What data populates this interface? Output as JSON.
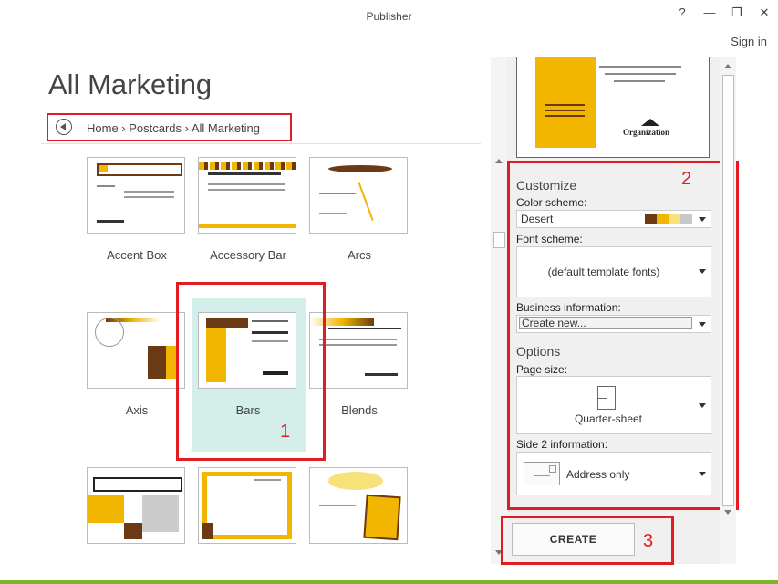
{
  "window": {
    "title": "Publisher",
    "help": "?",
    "minimize": "—",
    "restore": "❐",
    "close": "✕"
  },
  "account": {
    "sign_in": "Sign in"
  },
  "gallery": {
    "heading": "All Marketing",
    "breadcrumb": "Home  ›  Postcards  ›  All Marketing",
    "templates": [
      {
        "name": "Accent Box"
      },
      {
        "name": "Accessory Bar"
      },
      {
        "name": "Arcs"
      },
      {
        "name": "Axis"
      },
      {
        "name": "Bars",
        "selected": true
      },
      {
        "name": "Blends"
      }
    ]
  },
  "customize": {
    "heading": "Customize",
    "color_scheme_label": "Color scheme:",
    "color_scheme_value": "Desert",
    "swatches": [
      "#6b3a14",
      "#f2b600",
      "#f7e27a",
      "#c8c8c8"
    ],
    "font_scheme_label": "Font scheme:",
    "font_scheme_value": "(default template fonts)",
    "business_label": "Business information:",
    "business_value": "Create new..."
  },
  "options": {
    "heading": "Options",
    "page_size_label": "Page size:",
    "page_size_value": "Quarter-sheet",
    "side2_label": "Side 2 information:",
    "side2_value": "Address only"
  },
  "actions": {
    "create": "CREATE"
  },
  "annotations": {
    "n1": "1",
    "n2": "2",
    "n3": "3"
  },
  "preview": {
    "org": "Organization"
  },
  "colors": {
    "accent_red": "#e31b23",
    "selection": "#d4eeea",
    "status_bar": "#7fb432"
  }
}
